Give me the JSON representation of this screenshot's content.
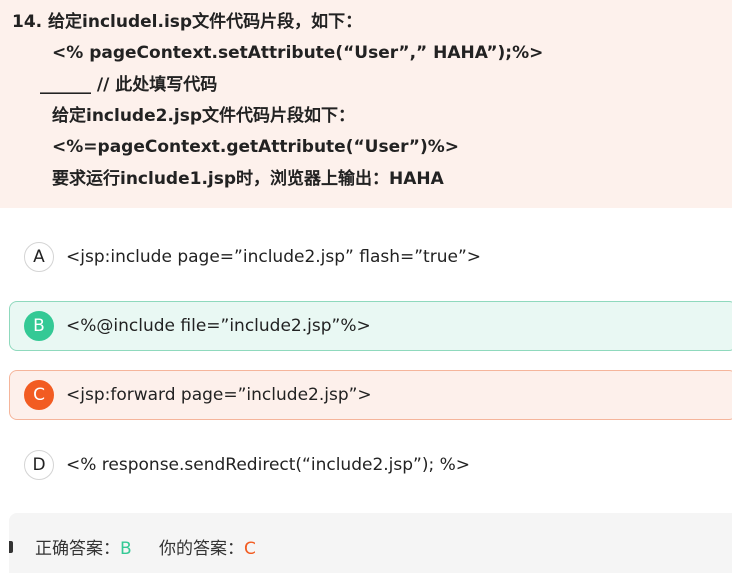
{
  "question": {
    "line1": "14. 给定includel.isp文件代码片段，如下：",
    "line2": "<% pageContext.setAttribute(“User”,” HAHA”);%>",
    "line3": "______ // 此处填写代码",
    "line4": "给定include2.jsp文件代码片段如下：",
    "line5": "<%=pageContext.getAttribute(“User”)%>",
    "line6": "要求运行include1.jsp时，浏览器上输出：HAHA"
  },
  "options": [
    {
      "letter": "A",
      "text": "<jsp:include page=”include2.jsp”  flash=”true”>"
    },
    {
      "letter": "B",
      "text": "<%@include file=”include2.jsp”%>"
    },
    {
      "letter": "C",
      "text": "<jsp:forward page=”include2.jsp”>"
    },
    {
      "letter": "D",
      "text": "<% response.sendRedirect(“include2.jsp”); %>"
    }
  ],
  "answer": {
    "correct_label": "正确答案：",
    "correct_value": "B",
    "mine_label": "你的答案：",
    "mine_value": "C"
  },
  "colors": {
    "correct": "#34c995",
    "wrong": "#f25c22",
    "question_bg": "#fdf1ec"
  }
}
